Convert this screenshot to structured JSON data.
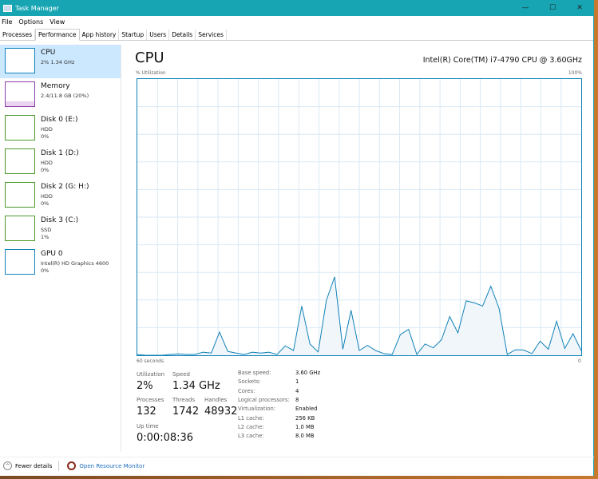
{
  "window": {
    "title": "Task Manager",
    "minimize": "—",
    "maximize": "☐",
    "close": "✕"
  },
  "menu": [
    "File",
    "Options",
    "View"
  ],
  "tabs": [
    "Processes",
    "Performance",
    "App history",
    "Startup",
    "Users",
    "Details",
    "Services"
  ],
  "active_tab": "Performance",
  "sidebar": [
    {
      "name": "CPU",
      "sub1": "2% 1.34 GHz",
      "sub2": "",
      "color": "#1182b8",
      "selected": true
    },
    {
      "name": "Memory",
      "sub1": "2.4/11.8 GB (20%)",
      "sub2": "",
      "color": "#8b3fa8"
    },
    {
      "name": "Disk 0 (E:)",
      "sub1": "HDD",
      "sub2": "0%",
      "color": "#4d9a29"
    },
    {
      "name": "Disk 1 (D:)",
      "sub1": "HDD",
      "sub2": "0%",
      "color": "#4d9a29"
    },
    {
      "name": "Disk 2 (G: H:)",
      "sub1": "HDD",
      "sub2": "0%",
      "color": "#4d9a29"
    },
    {
      "name": "Disk 3 (C:)",
      "sub1": "SSD",
      "sub2": "1%",
      "color": "#4d9a29"
    },
    {
      "name": "GPU 0",
      "sub1": "Intel(R) HD Graphics 4600",
      "sub2": "0%",
      "color": "#1182b8"
    }
  ],
  "main": {
    "title": "CPU",
    "model": "Intel(R) Core(TM) i7-4790 CPU @ 3.60GHz",
    "y_label": "% Utilization",
    "y_max_label": "100%",
    "x_left_label": "60 seconds",
    "x_right_label": "0",
    "stats": {
      "utilization_label": "Utilization",
      "utilization": "2%",
      "speed_label": "Speed",
      "speed": "1.34 GHz",
      "processes_label": "Processes",
      "processes": "132",
      "threads_label": "Threads",
      "threads": "1742",
      "handles_label": "Handles",
      "handles": "48932",
      "uptime_label": "Up time",
      "uptime": "0:00:08:36"
    },
    "specs": [
      [
        "Base speed:",
        "3.60 GHz"
      ],
      [
        "Sockets:",
        "1"
      ],
      [
        "Cores:",
        "4"
      ],
      [
        "Logical processors:",
        "8"
      ],
      [
        "Virtualization:",
        "Enabled"
      ],
      [
        "L1 cache:",
        "256 KB"
      ],
      [
        "L2 cache:",
        "1.0 MB"
      ],
      [
        "L3 cache:",
        "8.0 MB"
      ]
    ]
  },
  "chart_data": {
    "type": "area",
    "ylim": [
      0,
      100
    ],
    "xlabel": "60 seconds",
    "grid": true,
    "color": "#1182b8",
    "values": [
      0.3,
      0,
      0,
      0,
      0.3,
      0.5,
      0.3,
      0.3,
      1.1,
      0.8,
      8.4,
      1.4,
      0.8,
      0.3,
      1.1,
      0.8,
      1.1,
      0.3,
      3.4,
      1.7,
      17.8,
      4.1,
      1.2,
      19.9,
      28.4,
      2.2,
      16.3,
      1.7,
      3.6,
      1.7,
      0.6,
      0.3,
      7.5,
      9.4,
      0.3,
      4.1,
      2.7,
      5.6,
      14,
      8.1,
      19.7,
      19,
      17.8,
      25,
      17,
      0.3,
      2,
      1.9,
      0.6,
      5.1,
      2.2,
      12.3,
      2.5,
      7.8,
      1.7
    ]
  },
  "footer": {
    "fewer": "Fewer details",
    "monitor": "Open Resource Monitor"
  }
}
